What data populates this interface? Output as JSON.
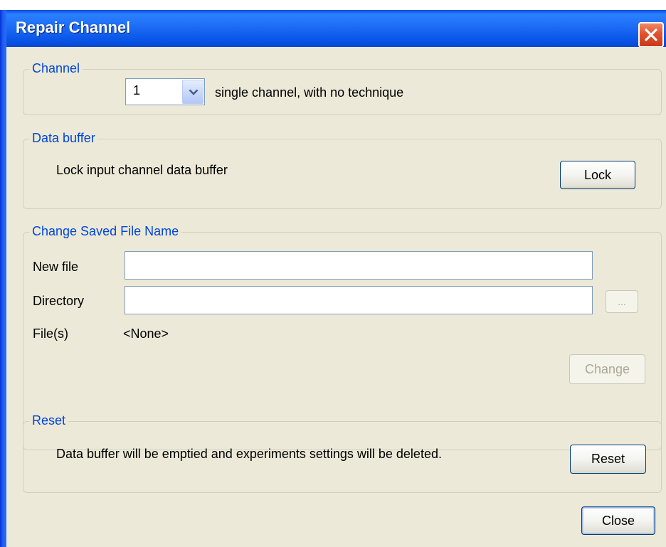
{
  "window": {
    "title": "Repair Channel"
  },
  "channel": {
    "legend": "Channel",
    "selected_value": "1",
    "description": "single channel, with no technique"
  },
  "data_buffer": {
    "legend": "Data buffer",
    "label": "Lock input channel data buffer",
    "lock_button": "Lock"
  },
  "change_file": {
    "legend": "Change Saved File Name",
    "new_file_label": "New file",
    "new_file_value": "",
    "directory_label": "Directory",
    "directory_value": "",
    "browse_button": "...",
    "files_label": "File(s)",
    "files_value": "<None>",
    "change_button": "Change"
  },
  "reset": {
    "legend": "Reset",
    "label": "Data buffer will be emptied and experiments settings will be deleted.",
    "reset_button": "Reset"
  },
  "footer": {
    "close_button": "Close"
  },
  "icons": {
    "close": "close-icon",
    "dropdown": "chevron-down-icon"
  },
  "colors": {
    "titlebar": "#0a56e8",
    "close_button": "#e2532c",
    "dialog_background": "#ece9d8",
    "group_legend": "#0046d5",
    "disabled_text": "#aca899"
  }
}
